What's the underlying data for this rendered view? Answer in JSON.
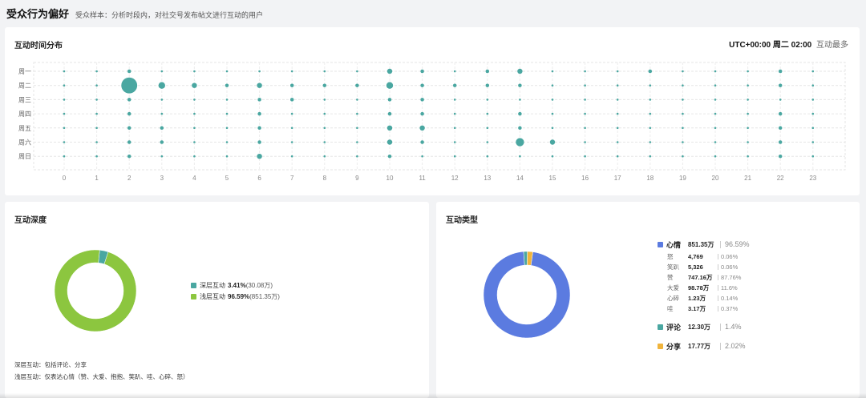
{
  "header": {
    "title": "受众行为偏好",
    "subtitle": "受众样本：分析时段内，对社交号发布帖文进行互动的用户"
  },
  "time_card": {
    "title": "互动时间分布",
    "summary_strong": "UTC+00:00 周二 02:00",
    "summary_weak": "互动最多"
  },
  "depth_card": {
    "title": "互动深度",
    "legend": [
      {
        "name": "深层互动",
        "pct": "3.41%",
        "paren": "(30.08万)",
        "color": "#4aa7a1"
      },
      {
        "name": "浅层互动",
        "pct": "96.59%",
        "paren": "(851.35万)",
        "color": "#8cc63f"
      }
    ],
    "notes": [
      "深层互动：包括评论、分享",
      "浅层互动：仅表达心情（赞、大爱、抱抱、笑趴、哇、心碎、怒）"
    ]
  },
  "type_card": {
    "title": "互动类型",
    "groups": [
      {
        "name": "心情",
        "value": "851.35万",
        "pct": "96.59%",
        "color": "#5b7be0",
        "subs": [
          {
            "name": "怒",
            "value": "4,769",
            "pct": "0.06%"
          },
          {
            "name": "笑趴",
            "value": "5,326",
            "pct": "0.06%"
          },
          {
            "name": "赞",
            "value": "747.16万",
            "pct": "87.76%"
          },
          {
            "name": "大爱",
            "value": "98.78万",
            "pct": "11.6%"
          },
          {
            "name": "心碎",
            "value": "1.23万",
            "pct": "0.14%"
          },
          {
            "name": "哇",
            "value": "3.17万",
            "pct": "0.37%"
          }
        ]
      },
      {
        "name": "评论",
        "value": "12.30万",
        "pct": "1.4%",
        "color": "#4aa7a1",
        "subs": []
      },
      {
        "name": "分享",
        "value": "17.77万",
        "pct": "2.02%",
        "color": "#f0b43c",
        "subs": []
      }
    ]
  },
  "chart_data": [
    {
      "type": "scatter",
      "title": "互动时间分布",
      "x": [
        0,
        1,
        2,
        3,
        4,
        5,
        6,
        7,
        8,
        9,
        10,
        11,
        12,
        13,
        14,
        15,
        16,
        17,
        18,
        19,
        20,
        21,
        22,
        23
      ],
      "y_categories": [
        "周一",
        "周二",
        "周三",
        "周四",
        "周五",
        "周六",
        "周日"
      ],
      "size_scale_note": "",
      "color": "#4aa7a1",
      "grid": true,
      "values": [
        [
          1,
          1,
          2,
          1,
          1,
          1,
          1,
          1,
          1,
          1,
          3,
          2,
          1,
          2,
          3,
          1,
          1,
          1,
          2,
          1,
          1,
          1,
          2,
          1
        ],
        [
          1,
          1,
          10,
          4,
          3,
          2,
          3,
          2,
          2,
          2,
          4,
          2,
          2,
          2,
          2,
          1,
          1,
          1,
          1,
          1,
          1,
          1,
          2,
          1
        ],
        [
          1,
          1,
          2,
          1,
          1,
          1,
          2,
          2,
          1,
          1,
          2,
          2,
          1,
          1,
          1,
          1,
          1,
          1,
          1,
          1,
          1,
          1,
          1,
          1
        ],
        [
          1,
          1,
          2,
          1,
          1,
          1,
          2,
          1,
          1,
          1,
          2,
          2,
          1,
          1,
          2,
          1,
          1,
          1,
          1,
          1,
          1,
          1,
          2,
          1
        ],
        [
          1,
          1,
          2,
          2,
          1,
          1,
          2,
          1,
          1,
          1,
          3,
          3,
          1,
          1,
          2,
          1,
          1,
          1,
          1,
          1,
          1,
          1,
          2,
          1
        ],
        [
          1,
          1,
          2,
          2,
          1,
          1,
          2,
          1,
          1,
          1,
          3,
          2,
          1,
          1,
          5,
          3,
          1,
          1,
          1,
          1,
          1,
          1,
          2,
          1
        ],
        [
          1,
          1,
          2,
          1,
          1,
          1,
          3,
          1,
          1,
          1,
          2,
          1,
          1,
          1,
          1,
          1,
          1,
          1,
          1,
          1,
          1,
          1,
          2,
          1
        ]
      ]
    },
    {
      "type": "pie",
      "title": "互动深度",
      "labels": [
        "深层互动",
        "浅层互动"
      ],
      "values": [
        3.41,
        96.59
      ],
      "colors": [
        "#4aa7a1",
        "#8cc63f"
      ]
    },
    {
      "type": "pie",
      "title": "互动类型",
      "labels": [
        "心情",
        "评论",
        "分享"
      ],
      "values": [
        96.59,
        1.4,
        2.02
      ],
      "colors": [
        "#5b7be0",
        "#4aa7a1",
        "#f0b43c"
      ]
    }
  ]
}
